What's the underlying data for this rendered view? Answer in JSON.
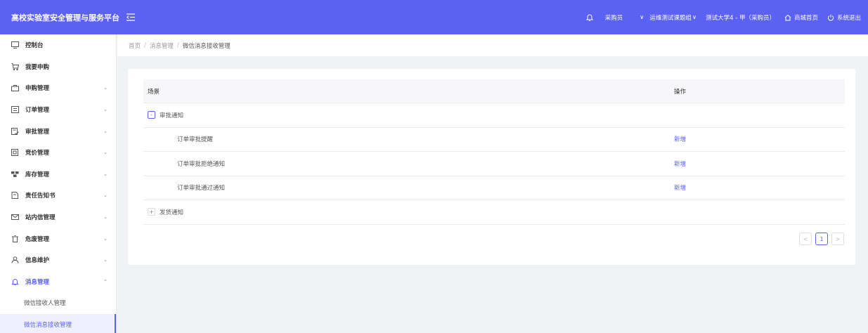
{
  "header": {
    "title": "高校实验室安全管理与服务平台",
    "role": "采购员",
    "group": "运维测试课题组",
    "user": "测试大学4 - 甲（采购员）",
    "mall_home": "商城首页",
    "logout": "系统退出"
  },
  "sidebar": {
    "items": [
      {
        "label": "控制台"
      },
      {
        "label": "我要申购"
      },
      {
        "label": "申购管理"
      },
      {
        "label": "订单管理"
      },
      {
        "label": "审批管理"
      },
      {
        "label": "竞价管理"
      },
      {
        "label": "库存管理"
      },
      {
        "label": "责任告知书"
      },
      {
        "label": "站内信管理"
      },
      {
        "label": "危废管理"
      },
      {
        "label": "信息维护"
      },
      {
        "label": "消息管理"
      }
    ],
    "sub_items": [
      {
        "label": "微信接收人管理"
      },
      {
        "label": "微信消息接收管理"
      }
    ]
  },
  "breadcrumb": {
    "home": "首页",
    "sep": "/",
    "section": "消息管理",
    "current": "微信消息接收管理"
  },
  "table": {
    "headers": {
      "scene": "场景",
      "action": "操作"
    },
    "groups": [
      {
        "label": "审批通知",
        "toggle": "-",
        "rows": [
          {
            "scene": "订单审批提醒",
            "action": "新增"
          },
          {
            "scene": "订单审批拒绝通知",
            "action": "新增"
          },
          {
            "scene": "订单审批通过通知",
            "action": "新增"
          }
        ]
      },
      {
        "label": "发货通知",
        "toggle": "+"
      }
    ]
  },
  "pagination": {
    "prev": "<",
    "page": "1",
    "next": ">"
  },
  "colors": {
    "accent": "#5b61f0"
  }
}
